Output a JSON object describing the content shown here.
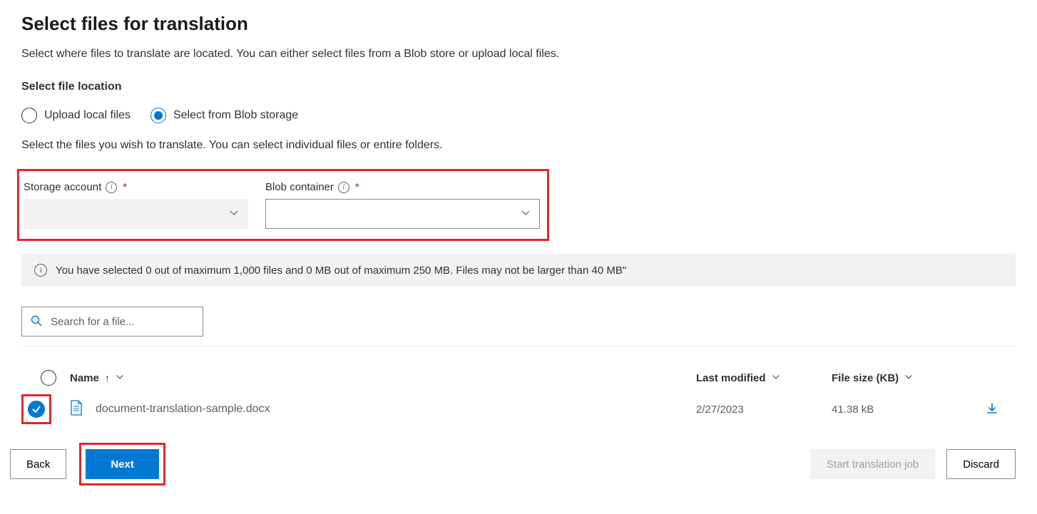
{
  "header": {
    "title": "Select files for translation",
    "subtitle": "Select where files to translate are located. You can either select files from a Blob store or upload local files."
  },
  "location": {
    "label": "Select file location",
    "option_upload": "Upload local files",
    "option_blob": "Select from Blob storage"
  },
  "instruction": "Select the files you wish to translate. You can select individual files or entire folders.",
  "fields": {
    "storage_label": "Storage account",
    "blob_label": "Blob container"
  },
  "status_message": "You have selected 0 out of maximum 1,000 files and 0 MB out of maximum 250 MB. Files may not be larger than 40 MB\"",
  "search": {
    "placeholder": "Search for a file..."
  },
  "table": {
    "headers": {
      "name": "Name",
      "last_modified": "Last modified",
      "file_size": "File size (KB)"
    },
    "rows": [
      {
        "name": "document-translation-sample.docx",
        "modified": "2/27/2023",
        "size": "41.38 kB"
      }
    ]
  },
  "footer": {
    "back": "Back",
    "next": "Next",
    "start": "Start translation job",
    "discard": "Discard"
  }
}
